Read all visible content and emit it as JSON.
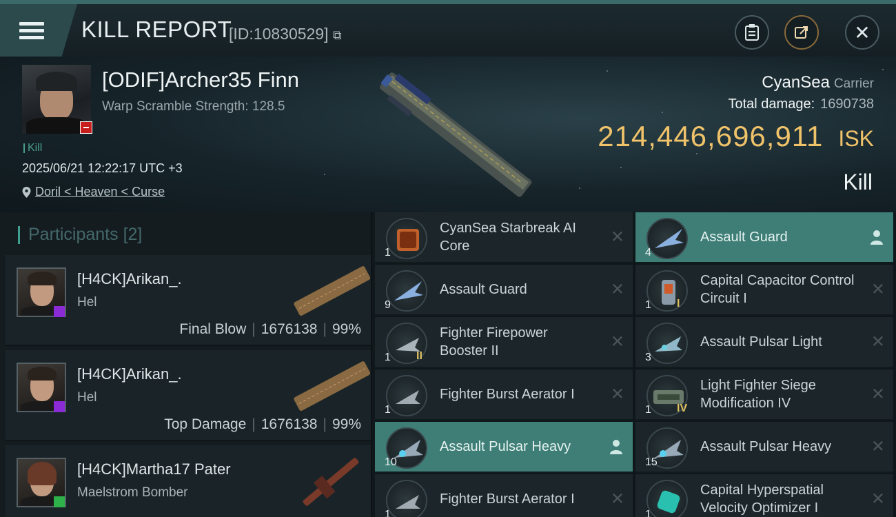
{
  "header": {
    "title": "KILL REPORT",
    "id_label": "[ID:10830529]"
  },
  "victim": {
    "name": "[ODIF]Archer35 Finn",
    "warp_scramble": "Warp Scramble Strength: 128.5",
    "kill_tag": "Kill",
    "datetime": "2025/06/21 12:22:17 UTC +3",
    "location": "Doril < Heaven < Curse",
    "ship_name": "CyanSea",
    "ship_class": "Carrier",
    "total_damage_label": "Total damage:",
    "total_damage": "1690738",
    "isk_value": "214,446,696,911",
    "isk_unit": "ISK",
    "result": "Kill"
  },
  "participants": {
    "title": "Participants",
    "count": "[2]",
    "list": [
      {
        "name": "[H4CK]Arikan_.",
        "ship": "Hel",
        "role": "Final Blow",
        "damage": "1676138",
        "percent": "99%"
      },
      {
        "name": "[H4CK]Arikan_.",
        "ship": "Hel",
        "role": "Top Damage",
        "damage": "1676138",
        "percent": "99%"
      },
      {
        "name": "[H4CK]Martha17 Pater",
        "ship": "Maelstrom Bomber"
      }
    ]
  },
  "items": [
    {
      "name": "CyanSea Starbreak AI Core",
      "qty": "1",
      "tier": "",
      "icon": "ai-core-icon",
      "highlight": false
    },
    {
      "name": "Assault Guard",
      "qty": "4",
      "tier": "",
      "icon": "fighter-guard-icon",
      "highlight": true
    },
    {
      "name": "Assault Guard",
      "qty": "9",
      "tier": "",
      "icon": "fighter-guard-icon",
      "highlight": false
    },
    {
      "name": "Capital Capacitor Control Circuit I",
      "qty": "1",
      "tier": "I",
      "icon": "capacitor-icon",
      "highlight": false
    },
    {
      "name": "Fighter Firepower Booster II",
      "qty": "1",
      "tier": "II",
      "icon": "booster-icon",
      "highlight": false
    },
    {
      "name": "Assault Pulsar Light",
      "qty": "3",
      "tier": "",
      "icon": "fighter-light-icon",
      "highlight": false
    },
    {
      "name": "Fighter Burst Aerator I",
      "qty": "1",
      "tier": "",
      "icon": "aerator-icon",
      "highlight": false
    },
    {
      "name": "Light Fighter Siege Modification IV",
      "qty": "1",
      "tier": "IV",
      "icon": "siege-mod-icon",
      "highlight": false
    },
    {
      "name": "Assault Pulsar Heavy",
      "qty": "10",
      "tier": "",
      "icon": "fighter-heavy-icon",
      "highlight": true
    },
    {
      "name": "Assault Pulsar Heavy",
      "qty": "15",
      "tier": "",
      "icon": "fighter-heavy-icon",
      "highlight": false
    },
    {
      "name": "Fighter Burst Aerator I",
      "qty": "1",
      "tier": "",
      "icon": "aerator-icon",
      "highlight": false
    },
    {
      "name": "Capital Hyperspatial Velocity Optimizer I",
      "qty": "1",
      "tier": "",
      "icon": "optimizer-icon",
      "highlight": false
    }
  ],
  "colors": {
    "isk": "#f0c36a",
    "accent": "#3e7e76",
    "kill_tag": "#4aa088"
  }
}
